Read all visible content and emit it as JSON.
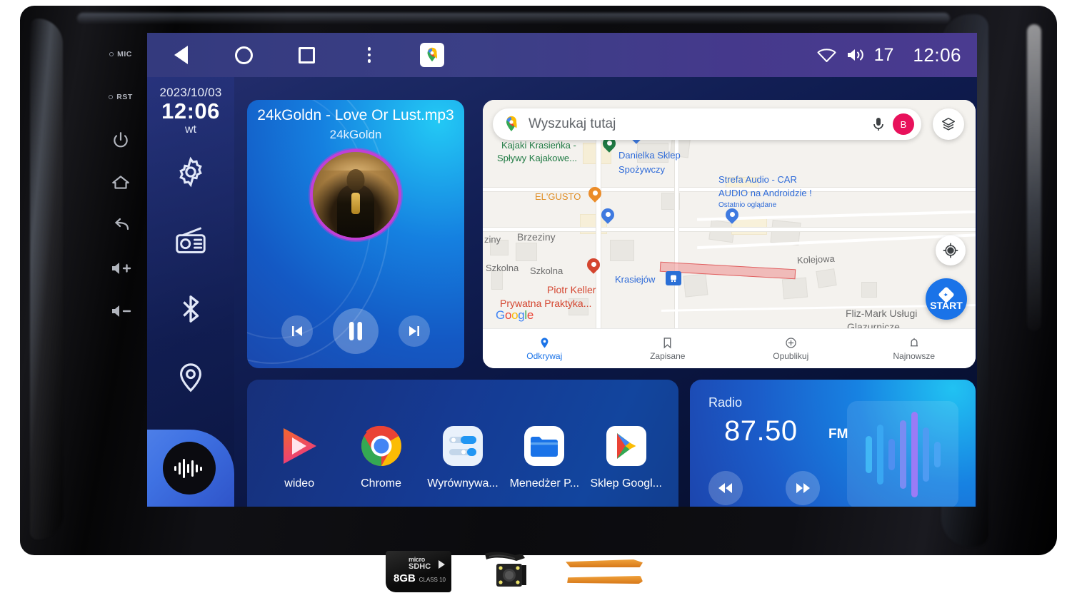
{
  "device": {
    "hardware_buttons": [
      {
        "name": "mic-indicator",
        "label": "MIC"
      },
      {
        "name": "reset-indicator",
        "label": "RST"
      },
      {
        "name": "power-button",
        "label": "power-icon"
      },
      {
        "name": "home-button",
        "label": "home-icon"
      },
      {
        "name": "back-button",
        "label": "back-icon"
      },
      {
        "name": "volume-up-button",
        "label": "volume-up-icon"
      },
      {
        "name": "volume-down-button",
        "label": "volume-down-icon"
      }
    ]
  },
  "statusbar": {
    "back_icon": "back-triangle-icon",
    "home_icon": "home-circle-icon",
    "recents_icon": "recents-square-icon",
    "more_icon": "overflow-menu-icon",
    "app_icon": "google-maps-icon",
    "wifi_icon": "wifi-icon",
    "volume_icon": "volume-icon",
    "volume_value": "17",
    "clock": "12:06"
  },
  "sidebar": {
    "date": "2023/10/03",
    "time": "12:06",
    "weekday": "wt",
    "items": [
      {
        "label": "settings-gear-icon"
      },
      {
        "label": "radio-icon"
      },
      {
        "label": "bluetooth-icon"
      },
      {
        "label": "location-pin-icon"
      }
    ],
    "visualizer": "audio-waveform-icon"
  },
  "music": {
    "title": "24kGoldn - Love Or Lust.mp3",
    "artist": "24kGoldn",
    "prev_icon": "skip-previous-icon",
    "play_icon": "pause-icon",
    "next_icon": "skip-next-icon"
  },
  "map": {
    "search": {
      "placeholder": "Wyszukaj tutaj",
      "logo_icon": "google-maps-pin-icon",
      "mic_icon": "microphone-icon",
      "avatar_initial": "B"
    },
    "layers_icon": "map-layers-icon",
    "locate_icon": "my-location-icon",
    "start_button": {
      "label": "START",
      "icon": "navigation-arrow-icon"
    },
    "labels": [
      {
        "text": "Kajaki Krasieńka -",
        "color": "green"
      },
      {
        "text": "Spływy Kajakowe...",
        "color": "green"
      },
      {
        "text": "Danielka Sklep",
        "color": "blue"
      },
      {
        "text": "Spożywczy",
        "color": "blue"
      },
      {
        "text": "EL'GUSTO",
        "color": "orange"
      },
      {
        "text": "Strefa Audio - CAR",
        "color": "blue"
      },
      {
        "text": "AUDIO na Androidzie !",
        "color": "blue"
      },
      {
        "text": "Ostatnio oglądane",
        "color": "blue"
      },
      {
        "text": "ziny",
        "color": "gray"
      },
      {
        "text": "Brzeziny",
        "color": "gray"
      },
      {
        "text": "Szkolna",
        "color": "gray"
      },
      {
        "text": "Szkolna",
        "color": "gray"
      },
      {
        "text": "Kolejowa",
        "color": "gray"
      },
      {
        "text": "Krasiejów",
        "color": "blue"
      },
      {
        "text": "Piotr Keller",
        "color": "red"
      },
      {
        "text": "Prywatna Praktyka...",
        "color": "red"
      },
      {
        "text": "Fliz-Mark Usługi",
        "color": "gray"
      },
      {
        "text": "Glazurnicze",
        "color": "gray"
      },
      {
        "text": "Google",
        "color": "logo"
      }
    ],
    "bottom_nav": [
      {
        "label": "Odkrywaj",
        "icon": "explore-pin-icon",
        "active": true
      },
      {
        "label": "Zapisane",
        "icon": "bookmark-icon",
        "active": false
      },
      {
        "label": "Opublikuj",
        "icon": "contribute-plus-icon",
        "active": false
      },
      {
        "label": "Najnowsze",
        "icon": "bell-icon",
        "active": false
      }
    ]
  },
  "apps": [
    {
      "label": "wideo",
      "icon": "video-player-icon"
    },
    {
      "label": "Chrome",
      "icon": "chrome-icon"
    },
    {
      "label": "Wyrównywa...",
      "icon": "equalizer-settings-icon"
    },
    {
      "label": "Menedżer P...",
      "icon": "file-manager-folder-icon"
    },
    {
      "label": "Sklep Googl...",
      "icon": "google-play-icon"
    }
  ],
  "radio": {
    "title": "Radio",
    "frequency": "87.50",
    "band": "FM",
    "prev_icon": "rewind-icon",
    "next_icon": "fast-forward-icon",
    "visualizer_icon": "equalizer-bars-icon"
  },
  "accessories": [
    {
      "name": "microsd-card",
      "capacity": "8GB",
      "brand_micro": "micro",
      "brand_sdhc": "SDHC",
      "class": "CLASS 10"
    },
    {
      "name": "reverse-camera",
      "label": "reverse-camera-icon"
    },
    {
      "name": "pry-tools",
      "label": "trim-removal-tools-icon"
    }
  ],
  "colors": {
    "accent_blue": "#1a73e8",
    "screen_blue": "#1580e0",
    "bezel_black": "#0a0a0c"
  }
}
